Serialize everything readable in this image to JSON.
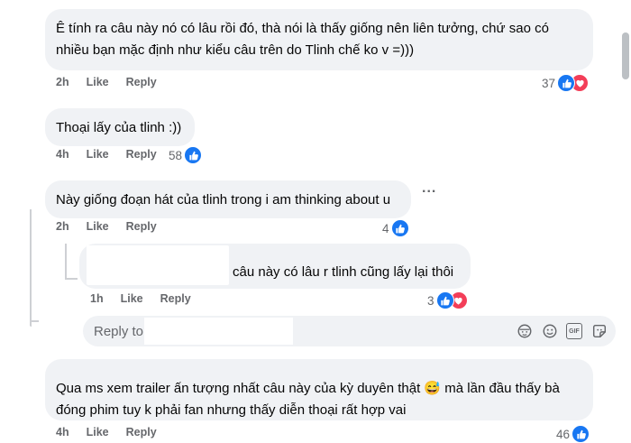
{
  "comments": [
    {
      "lines": [
        "Ê tính ra câu này nó có lâu rồi đó, thà nói là thấy giống nên liên tưởng, chứ sao có",
        "nhiều bạn mặc định như kiểu câu trên do Tlinh chế ko v =)))"
      ],
      "time": "2h",
      "like": "Like",
      "reply": "Reply",
      "reaction_count": "37",
      "reactions": [
        "like",
        "love"
      ]
    },
    {
      "lines": [
        "Thoại lấy của tlinh :))"
      ],
      "time": "4h",
      "like": "Like",
      "reply": "Reply",
      "reaction_count": "58",
      "reactions": [
        "like"
      ]
    },
    {
      "lines": [
        "Này giống đoạn hát của tlinh trong i am thinking about u"
      ],
      "time": "2h",
      "like": "Like",
      "reply": "Reply",
      "reaction_count": "4",
      "reactions": [
        "like"
      ]
    },
    {
      "lines": [
        "câu này có lâu r tlinh cũng lấy lại thôi"
      ],
      "time": "1h",
      "like": "Like",
      "reply": "Reply",
      "reaction_count": "3",
      "reactions": [
        "like",
        "love"
      ]
    },
    {
      "lines": [
        "Qua ms xem trailer ấn tượng nhất câu này của kỳ duyên thật 😅 mà lần đầu thấy bà",
        "đóng phim tuy k phải fan nhưng thấy diễn thoại rất hợp vai"
      ],
      "time": "4h",
      "like": "Like",
      "reply": "Reply",
      "reaction_count": "46",
      "reactions": [
        "like"
      ]
    }
  ],
  "more_options": "...",
  "reply_box": {
    "placeholder": "Reply to",
    "tools": [
      "avatar-sticker-icon",
      "emoji-icon",
      "gif-icon",
      "sticker-icon"
    ],
    "gif_label": "GIF"
  },
  "colors": {
    "bubble": "#f0f2f5",
    "meta": "#65676b",
    "like": "#1877f2",
    "love": "#f33e58"
  }
}
